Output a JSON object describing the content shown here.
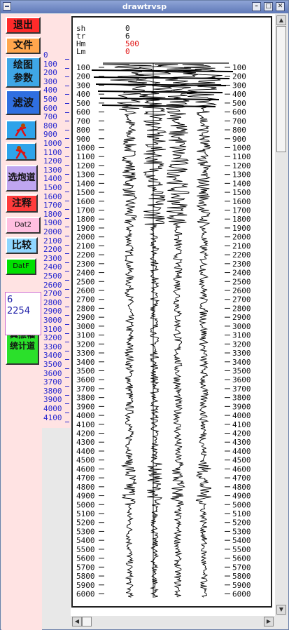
{
  "window": {
    "title": "drawtrvsp"
  },
  "titlebar_buttons": [
    {
      "glyph": "–"
    },
    {
      "glyph": "□"
    },
    {
      "glyph": "✕"
    }
  ],
  "sidebar": {
    "buttons": [
      {
        "id": "exit",
        "label": "退出",
        "bg": "#ff2a2a",
        "color": "#111111"
      },
      {
        "id": "file",
        "label": "文件",
        "bg": "#ffa64d",
        "color": "#111111"
      },
      {
        "id": "plot-params",
        "label": "绘图参数",
        "bg": "#3fa6e6",
        "color": "#111111"
      },
      {
        "id": "filter",
        "label": "滤波",
        "bg": "#2f6fe0",
        "color": "#111111"
      },
      {
        "id": "run-forward",
        "label": "",
        "bg": "#2ea3ea",
        "icon": "runner-right-icon"
      },
      {
        "id": "run-back",
        "label": "",
        "bg": "#2ea3ea",
        "icon": "runner-left-icon"
      },
      {
        "id": "select-shot-trace",
        "label": "选炮道",
        "bg": "#bfa6f0",
        "color": "#111111"
      },
      {
        "id": "annotate",
        "label": "注释",
        "bg": "#ff3b3b",
        "color": "#111111"
      },
      {
        "id": "dat2",
        "label": "Dat2",
        "bg": "#ffbfe0",
        "color": "#111111"
      },
      {
        "id": "compare",
        "label": "比较",
        "bg": "#8fd6ff",
        "color": "#111111"
      },
      {
        "id": "datf",
        "label": "DatF",
        "bg": "#00e000",
        "color": "#111111"
      },
      {
        "id": "true-amp",
        "label": "真振幅统计道",
        "bg": "#2be02b",
        "color": "#111111"
      }
    ],
    "info_box": {
      "line1": "6",
      "line2": "2254"
    }
  },
  "header": {
    "labels": [
      {
        "key": "sh",
        "value": "0",
        "color": "#111111"
      },
      {
        "key": "tr",
        "value": "6",
        "color": "#111111"
      },
      {
        "key": "Hm",
        "value": "500",
        "color": "#e01010"
      },
      {
        "key": "Lm",
        "value": "0",
        "color": "#e01010"
      }
    ]
  },
  "left_axis_ticks": [
    "0",
    "100",
    "200",
    "300",
    "400",
    "500",
    "600",
    "700",
    "800",
    "900",
    "1000",
    "1100",
    "1200",
    "1300",
    "1400",
    "1500",
    "1600",
    "1700",
    "1800",
    "1900",
    "2000",
    "2100",
    "2200",
    "2300",
    "2400",
    "2500",
    "2600",
    "2700",
    "2800",
    "2900",
    "3000",
    "3100",
    "3200",
    "3300",
    "3400",
    "3500",
    "3600",
    "3700",
    "3800",
    "3900",
    "4000",
    "4100"
  ],
  "depth_ticks": [
    "100",
    "200",
    "300",
    "400",
    "500",
    "600",
    "700",
    "800",
    "900",
    "1000",
    "1100",
    "1200",
    "1300",
    "1400",
    "1500",
    "1600",
    "1700",
    "1800",
    "1900",
    "2000",
    "2100",
    "2200",
    "2300",
    "2400",
    "2500",
    "2600",
    "2700",
    "2800",
    "2900",
    "3000",
    "3100",
    "3200",
    "3300",
    "3400",
    "3500",
    "3600",
    "3700",
    "3800",
    "3900",
    "4000",
    "4100",
    "4200",
    "4300",
    "4400",
    "4500",
    "4600",
    "4700",
    "4800",
    "4900",
    "5000",
    "5100",
    "5200",
    "5300",
    "5400",
    "5500",
    "5600",
    "5700",
    "5800",
    "5900",
    "6000"
  ],
  "colors": {
    "sidebar_bg": "#ffe3e3",
    "axis_blue": "#2a2ad0",
    "title_bar": "#6f88c8"
  }
}
